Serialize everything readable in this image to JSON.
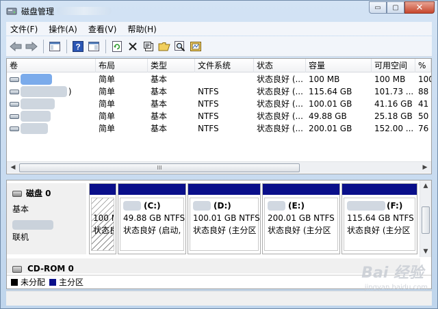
{
  "window": {
    "title": "磁盘管理",
    "controls": {
      "minimize": "▭",
      "maximize": "▢",
      "close": "✕"
    }
  },
  "menu": [
    "文件(F)",
    "操作(A)",
    "查看(V)",
    "帮助(H)"
  ],
  "toolbar": {
    "icons": [
      "back-arrow-icon",
      "forward-arrow-icon",
      "console-tree-icon",
      "help-icon",
      "properties-pane-icon",
      "refresh-icon",
      "delete-icon",
      "properties-icon",
      "open-folder-icon",
      "search-icon",
      "wizard-icon"
    ]
  },
  "list": {
    "columns": [
      "卷",
      "布局",
      "类型",
      "文件系统",
      "状态",
      "容量",
      "可用空间",
      "%"
    ],
    "rows": [
      {
        "volume": "",
        "layout": "简单",
        "type": "基本",
        "fs": "",
        "status": "状态良好 (...",
        "capacity": "100 MB",
        "free": "100 MB",
        "pct": "100"
      },
      {
        "volume": ")",
        "layout": "简单",
        "type": "基本",
        "fs": "NTFS",
        "status": "状态良好 (...",
        "capacity": "115.64 GB",
        "free": "101.73 ...",
        "pct": "88"
      },
      {
        "volume": "",
        "layout": "简单",
        "type": "基本",
        "fs": "NTFS",
        "status": "状态良好 (...",
        "capacity": "100.01 GB",
        "free": "41.16 GB",
        "pct": "41"
      },
      {
        "volume": "",
        "layout": "简单",
        "type": "基本",
        "fs": "NTFS",
        "status": "状态良好 (...",
        "capacity": "49.88 GB",
        "free": "25.18 GB",
        "pct": "50"
      },
      {
        "volume": "",
        "layout": "简单",
        "type": "基本",
        "fs": "NTFS",
        "status": "状态良好 (...",
        "capacity": "200.01 GB",
        "free": "152.00 ...",
        "pct": "76"
      }
    ],
    "scroll_thumb": "III"
  },
  "disk0": {
    "name": "磁盘 0",
    "kind": "基本",
    "state": "联机",
    "partitions": [
      {
        "label": "",
        "size": "100 M",
        "status": "状态良",
        "system": true
      },
      {
        "label": "(C:)",
        "size": "49.88 GB NTFS",
        "status": "状态良好 (启动,",
        "system": false
      },
      {
        "label": "(D:)",
        "size": "100.01 GB NTFS",
        "status": "状态良好 (主分区",
        "system": false
      },
      {
        "label": "(E:)",
        "size": "200.01 GB NTFS",
        "status": "状态良好 (主分区",
        "system": false
      },
      {
        "label": "(F:)",
        "size": "115.64 GB NTFS",
        "status": "状态良好 (主分区",
        "system": false
      }
    ]
  },
  "cdrom": {
    "name": "CD-ROM 0"
  },
  "legend": [
    {
      "label": "未分配",
      "color": "#000000"
    },
    {
      "label": "主分区",
      "color": "#0a0f8a"
    }
  ],
  "watermark": {
    "text": "Bai 经验",
    "sub": "jingyan.baidu.com"
  }
}
